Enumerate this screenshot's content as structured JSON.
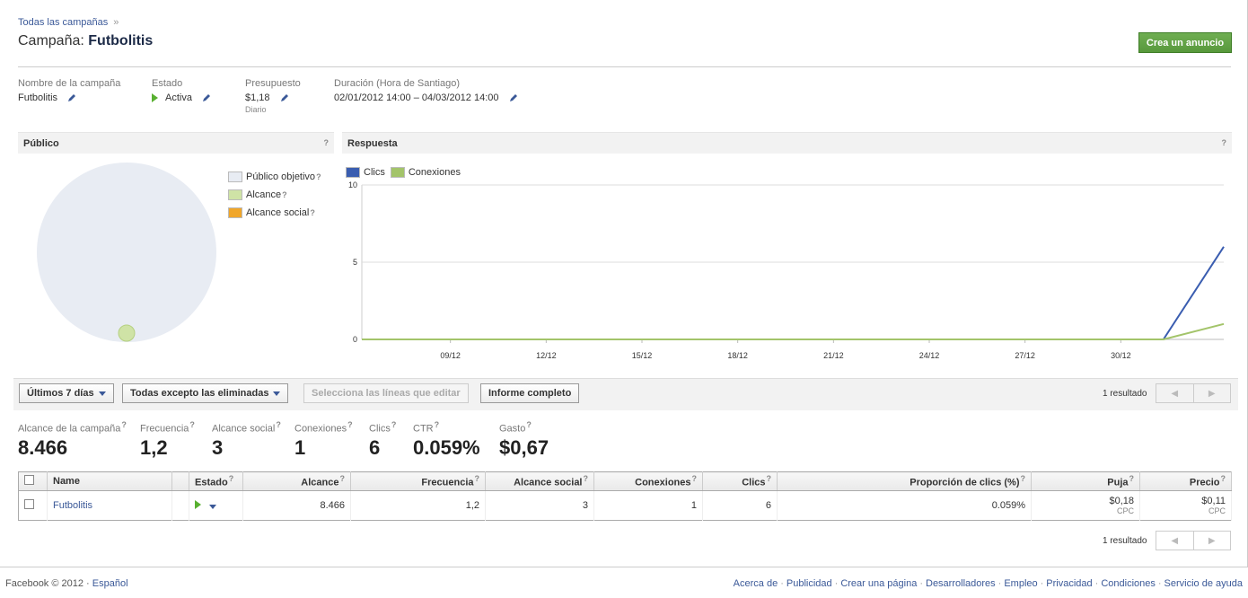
{
  "breadcrumb": {
    "link": "Todas las campañas",
    "sep": "»"
  },
  "header": {
    "prefix": "Campaña:",
    "name": "Futbolitis",
    "create_button": "Crea un anuncio"
  },
  "info": {
    "name_label": "Nombre de la campaña",
    "name_value": "Futbolitis",
    "status_label": "Estado",
    "status_value": "Activa",
    "budget_label": "Presupuesto",
    "budget_value": "$1,18",
    "budget_sub": "Diario",
    "duration_label": "Duración (Hora de Santiago)",
    "duration_value": "02/01/2012 14:00 – 04/03/2012 14:00"
  },
  "audience": {
    "title": "Público",
    "help": "?",
    "legend": [
      {
        "label": "Público objetivo",
        "color": "#e8ecf3"
      },
      {
        "label": "Alcance",
        "color": "#cfe3a6"
      },
      {
        "label": "Alcance social",
        "color": "#f0a62a"
      }
    ]
  },
  "response": {
    "title": "Respuesta",
    "help": "?"
  },
  "chart_data": {
    "type": "line",
    "x": [
      "09/12",
      "12/12",
      "15/12",
      "18/12",
      "21/12",
      "24/12",
      "27/12",
      "30/12"
    ],
    "ylim": [
      0,
      10
    ],
    "yticks": [
      "10",
      "5",
      "0"
    ],
    "series": [
      {
        "name": "Clics",
        "color": "#3a5db0",
        "points": [
          [
            0,
            0
          ],
          [
            0.93,
            0
          ],
          [
            1.0,
            6
          ]
        ]
      },
      {
        "name": "Conexiones",
        "color": "#a3c46a",
        "points": [
          [
            0,
            0
          ],
          [
            0.93,
            0
          ],
          [
            1.0,
            1
          ]
        ]
      }
    ]
  },
  "toolbar": {
    "period": "Últimos 7 días",
    "filter": "Todas excepto las eliminadas",
    "edit": "Selecciona las líneas que editar",
    "report": "Informe completo",
    "results": "1 resultado",
    "prev": "◀",
    "next": "▶"
  },
  "stats": [
    {
      "label": "Alcance de la campaña",
      "value": "8.466"
    },
    {
      "label": "Frecuencia",
      "value": "1,2"
    },
    {
      "label": "Alcance social",
      "value": "3"
    },
    {
      "label": "Conexiones",
      "value": "1"
    },
    {
      "label": "Clics",
      "value": "6"
    },
    {
      "label": "CTR",
      "value": "0.059%"
    },
    {
      "label": "Gasto",
      "value": "$0,67"
    }
  ],
  "table": {
    "headers": [
      "Name",
      "Estado",
      "Alcance",
      "Frecuencia",
      "Alcance social",
      "Conexiones",
      "Clics",
      "Proporción de clics (%)",
      "Puja",
      "Precio"
    ],
    "row": {
      "name": "Futbolitis",
      "alcance": "8.466",
      "frecuencia": "1,2",
      "social": "3",
      "conexiones": "1",
      "clics": "6",
      "ctr": "0.059%",
      "puja": "$0,18",
      "puja_sub": "CPC",
      "precio": "$0,11",
      "precio_sub": "CPC"
    }
  },
  "bottom_results": "1 resultado",
  "footer": {
    "copyright": "Facebook © 2012 ·",
    "lang": "Español",
    "links": [
      "Acerca de",
      "Publicidad",
      "Crear una página",
      "Desarrolladores",
      "Empleo",
      "Privacidad",
      "Condiciones",
      "Servicio de ayuda"
    ]
  }
}
